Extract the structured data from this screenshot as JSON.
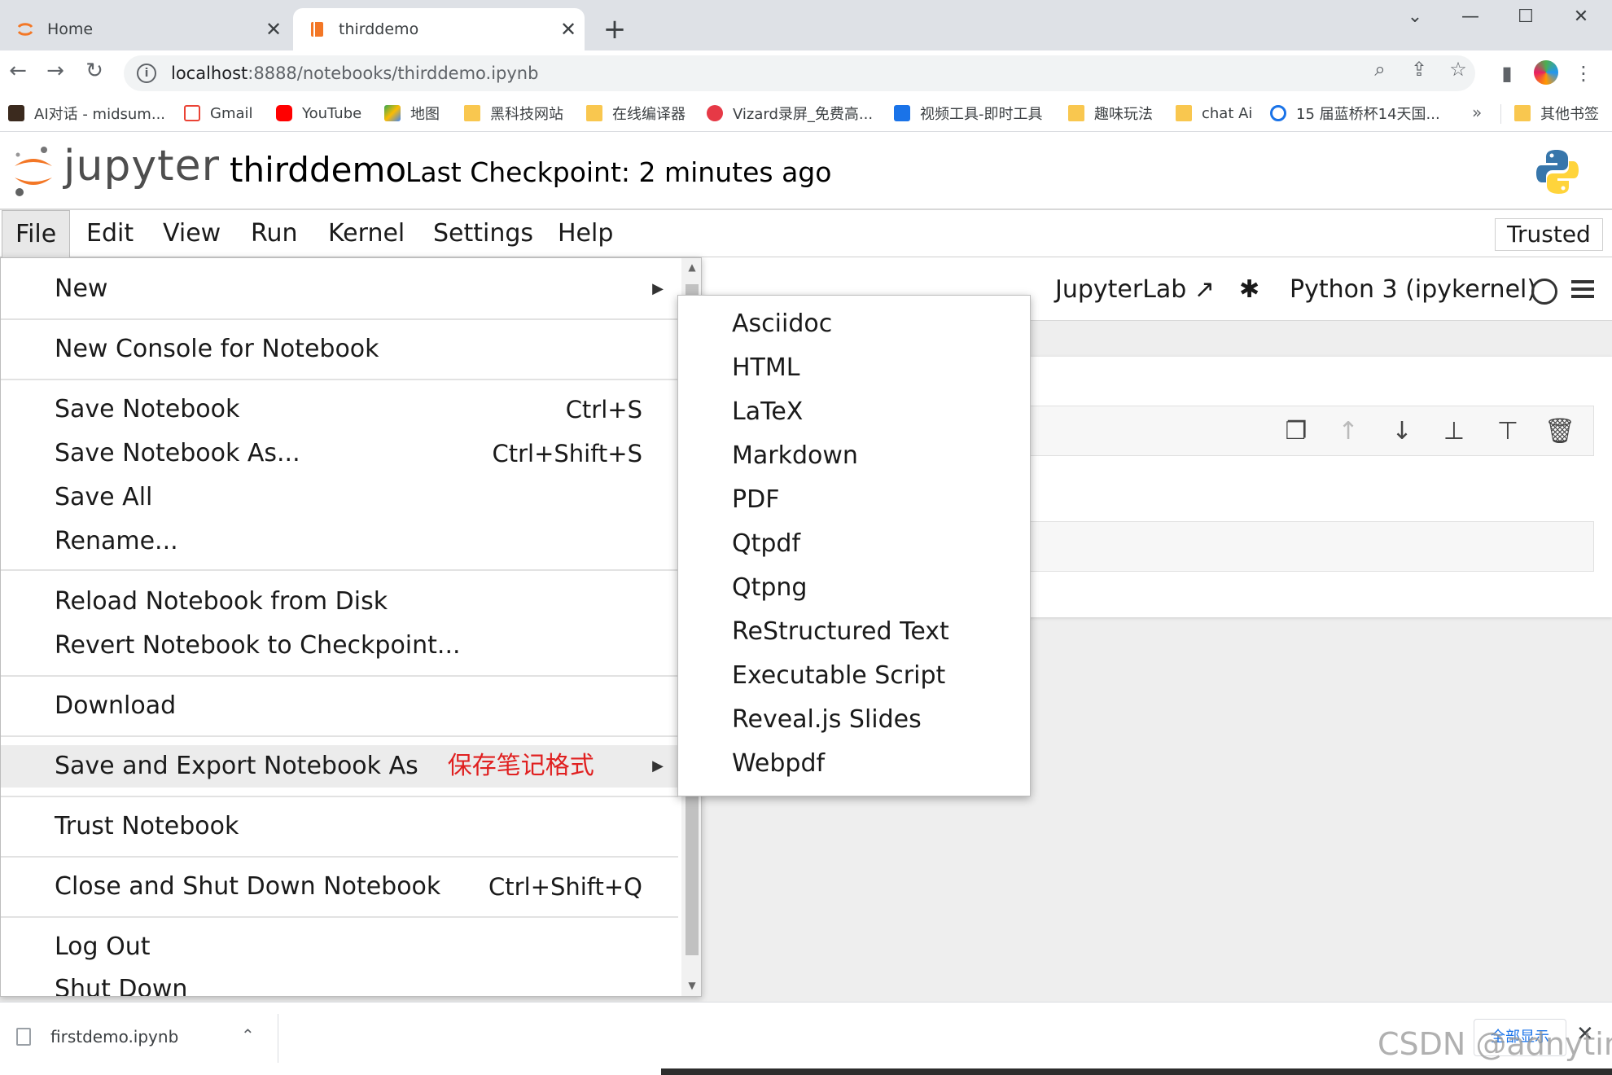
{
  "browser": {
    "tabs": [
      {
        "title": "Home",
        "active": false
      },
      {
        "title": "thirddemo",
        "active": true
      }
    ],
    "new_tab": "+",
    "window_controls": {
      "collapse": "⌄",
      "minimize": "—",
      "maximize": "☐",
      "close": "✕"
    },
    "url_host": "localhost",
    "url_rest": ":8888/notebooks/thirddemo.ipynb",
    "bookmarks": [
      {
        "label": "AI对话 - midsum...",
        "icon": "ai-chat-icon",
        "color": "#3b2a1e"
      },
      {
        "label": "Gmail",
        "icon": "gmail-icon",
        "color": "#ea4335"
      },
      {
        "label": "YouTube",
        "icon": "youtube-icon",
        "color": "#ff0000"
      },
      {
        "label": "地图",
        "icon": "maps-icon",
        "color": "#34a853"
      },
      {
        "label": "黑科技网站",
        "icon": "folder-icon",
        "color": "#f9c74f"
      },
      {
        "label": "在线编译器",
        "icon": "folder-icon",
        "color": "#f9c74f"
      },
      {
        "label": "Vizard录屏_免费高...",
        "icon": "vizard-icon",
        "color": "#e63946"
      },
      {
        "label": "视频工具-即时工具",
        "icon": "tool-icon",
        "color": "#1a73e8"
      },
      {
        "label": "趣味玩法",
        "icon": "folder-icon",
        "color": "#f9c74f"
      },
      {
        "label": "chat Ai",
        "icon": "folder-icon",
        "color": "#f9c74f"
      },
      {
        "label": "15 届蓝桥杯14天国...",
        "icon": "link-icon",
        "color": "#1a73e8"
      }
    ],
    "bookmarks_more": "»",
    "other_bookmarks": "其他书签"
  },
  "jupyter": {
    "logo_text": "jupyter",
    "notebook_title": "thirddemo",
    "checkpoint": "Last Checkpoint: 2 minutes ago",
    "menus": [
      "File",
      "Edit",
      "View",
      "Run",
      "Kernel",
      "Settings",
      "Help"
    ],
    "trusted": "Trusted",
    "toolbar": {
      "jupyterlab": "JupyterLab",
      "kernel_name": "Python 3 (ipykernel)"
    }
  },
  "file_menu": {
    "items": [
      {
        "label": "New",
        "shortcut": "",
        "submenu": true
      },
      {
        "label": "New Console for Notebook",
        "shortcut": ""
      },
      {
        "label": "Save Notebook",
        "shortcut": "Ctrl+S"
      },
      {
        "label": "Save Notebook As...",
        "shortcut": "Ctrl+Shift+S"
      },
      {
        "label": "Save All",
        "shortcut": ""
      },
      {
        "label": "Rename...",
        "shortcut": ""
      },
      {
        "label": "Reload Notebook from Disk",
        "shortcut": ""
      },
      {
        "label": "Revert Notebook to Checkpoint...",
        "shortcut": ""
      },
      {
        "label": "Download",
        "shortcut": ""
      },
      {
        "label": "Save and Export Notebook As",
        "shortcut": "",
        "submenu": true,
        "annotation": "保存笔记格式"
      },
      {
        "label": "Trust Notebook",
        "shortcut": ""
      },
      {
        "label": "Close and Shut Down Notebook",
        "shortcut": "Ctrl+Shift+Q"
      },
      {
        "label": "Log Out",
        "shortcut": ""
      },
      {
        "label": "Shut Down",
        "shortcut": ""
      }
    ]
  },
  "export_submenu": {
    "items": [
      "Asciidoc",
      "HTML",
      "LaTeX",
      "Markdown",
      "PDF",
      "Qtpdf",
      "Qtpng",
      "ReStructured Text",
      "Executable Script",
      "Reveal.js Slides",
      "Webpdf"
    ]
  },
  "download_bar": {
    "file": "firstdemo.ipynb",
    "show_all": "全部显示",
    "close": "✕"
  },
  "watermark": "CSDN @adnyting",
  "colors": {
    "jupyter_orange": "#f37726",
    "annotation_red": "#e02020",
    "link_blue": "#1a73e8"
  }
}
